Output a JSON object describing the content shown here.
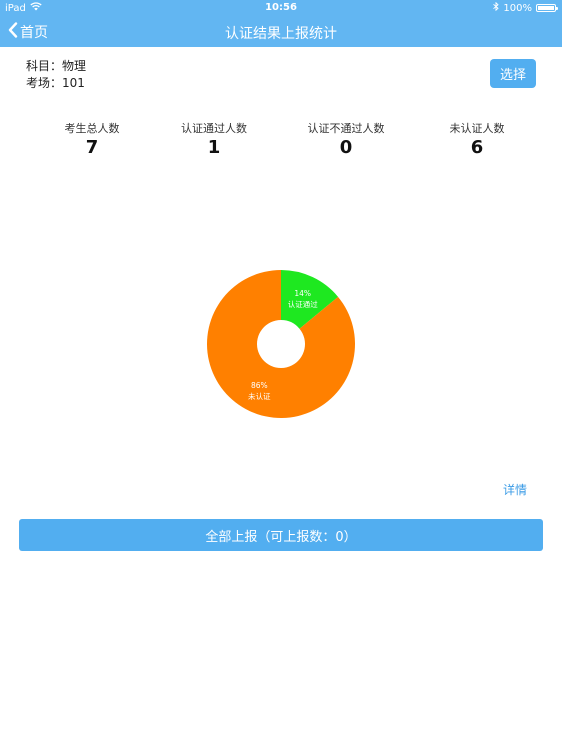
{
  "status_bar": {
    "device": "iPad",
    "time": "10:56",
    "battery": "100%",
    "battery_level": 1.0
  },
  "nav": {
    "back_label": "首页",
    "title": "认证结果上报统计"
  },
  "info": {
    "subject_label": "科目：",
    "subject_value": "物理",
    "room_label": "考场：",
    "room_value": "101"
  },
  "select_button": "选择",
  "stats": [
    {
      "label": "考生总人数",
      "value": "7"
    },
    {
      "label": "认证通过人数",
      "value": "1"
    },
    {
      "label": "认证不通过人数",
      "value": "0"
    },
    {
      "label": "未认证人数",
      "value": "6"
    }
  ],
  "chart_data": {
    "type": "pie",
    "donut": true,
    "slices": [
      {
        "label": "认证通过",
        "value": 14,
        "display": "14%",
        "color": "#1ee820"
      },
      {
        "label": "未认证",
        "value": 86,
        "display": "86%",
        "color": "#ff8000"
      }
    ]
  },
  "detail_link": "详情",
  "report_button": "全部上报（可上报数：0）"
}
